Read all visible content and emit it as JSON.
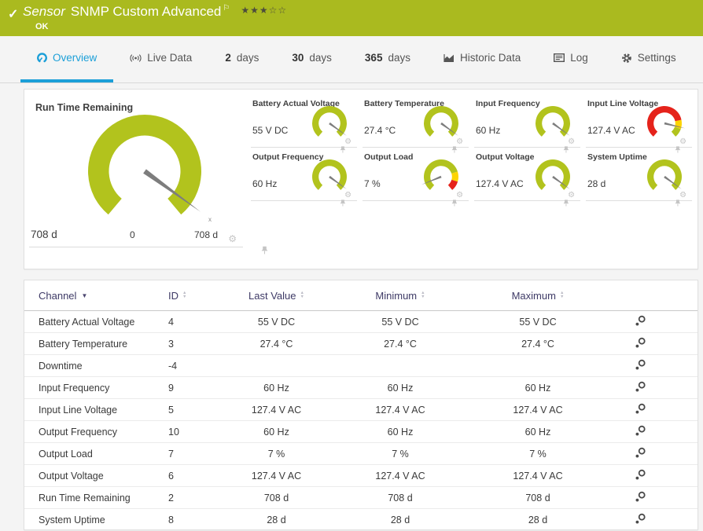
{
  "header": {
    "kind_label": "Sensor",
    "title": "SNMP Custom Advanced",
    "status_text": "OK",
    "stars_filled": "★★★",
    "stars_empty": "☆☆",
    "icons": {
      "checkmark": "✓",
      "flag": "⚐",
      "gear": "⚙"
    }
  },
  "tabs": [
    {
      "label": "Overview",
      "icon": "gauge-icon",
      "active": true
    },
    {
      "label": "Live Data",
      "icon": "live-data-icon",
      "active": false
    },
    {
      "strong": "2",
      "label": "days",
      "active": false
    },
    {
      "strong": "30",
      "label": "days",
      "active": false
    },
    {
      "strong": "365",
      "label": "days",
      "active": false
    },
    {
      "label": "Historic Data",
      "icon": "historic-data-icon",
      "active": false
    },
    {
      "label": "Log",
      "icon": "log-icon",
      "active": false
    },
    {
      "label": "Settings",
      "icon": "gear-icon",
      "active": false
    }
  ],
  "colors": {
    "header_bg": "#aaba1f",
    "accent_blue": "#1b9fd8",
    "gauge_green": "#b2c31d",
    "gauge_yellow": "#fdd400",
    "gauge_red": "#e5231b",
    "needle_gray": "#7d7d7d"
  },
  "main_gauge": {
    "title": "Run Time Remaining",
    "value": "708 d",
    "min_label": "0",
    "max_label": "708 d",
    "needle_marker": "x",
    "needle": 0.95,
    "segments": [
      {
        "color": "#b2c31d",
        "from": 0,
        "to": 1
      }
    ]
  },
  "small_gauges": [
    {
      "title": "Battery Actual Voltage",
      "value": "55 V DC",
      "needle": 0.95,
      "segments": [
        {
          "color": "#b2c31d",
          "from": 0,
          "to": 1
        }
      ]
    },
    {
      "title": "Battery Temperature",
      "value": "27.4 °C",
      "needle": 0.95,
      "segments": [
        {
          "color": "#b2c31d",
          "from": 0,
          "to": 1
        }
      ]
    },
    {
      "title": "Input Frequency",
      "value": "60 Hz",
      "needle": 0.95,
      "segments": [
        {
          "color": "#b2c31d",
          "from": 0,
          "to": 1
        }
      ]
    },
    {
      "title": "Input Line Voltage",
      "value": "127.4 V AC",
      "needle": 0.87,
      "segments": [
        {
          "color": "#e5231b",
          "from": 0,
          "to": 0.78
        },
        {
          "color": "#fdd400",
          "from": 0.78,
          "to": 0.89
        },
        {
          "color": "#b2c31d",
          "from": 0.89,
          "to": 1
        }
      ]
    },
    {
      "title": "Output Frequency",
      "value": "60 Hz",
      "needle": 0.95,
      "segments": [
        {
          "color": "#b2c31d",
          "from": 0,
          "to": 1
        }
      ]
    },
    {
      "title": "Output Load",
      "value": "7 %",
      "needle": 0.1,
      "segments": [
        {
          "color": "#b2c31d",
          "from": 0,
          "to": 0.76
        },
        {
          "color": "#fdd400",
          "from": 0.76,
          "to": 0.88
        },
        {
          "color": "#e5231b",
          "from": 0.88,
          "to": 1
        }
      ]
    },
    {
      "title": "Output Voltage",
      "value": "127.4 V AC",
      "needle": 0.95,
      "segments": [
        {
          "color": "#b2c31d",
          "from": 0,
          "to": 1
        }
      ]
    },
    {
      "title": "System Uptime",
      "value": "28 d",
      "needle": 0.95,
      "segments": [
        {
          "color": "#b2c31d",
          "from": 0,
          "to": 1
        }
      ]
    }
  ],
  "table": {
    "columns": [
      {
        "label": "Channel",
        "sort": "desc"
      },
      {
        "label": "ID",
        "sort": "both"
      },
      {
        "label": "Last Value",
        "sort": "both"
      },
      {
        "label": "Minimum",
        "sort": "both"
      },
      {
        "label": "Maximum",
        "sort": "both"
      }
    ],
    "rows": [
      {
        "channel": "Battery Actual Voltage",
        "id": "4",
        "last": "55 V DC",
        "min": "55 V DC",
        "max": "55 V DC"
      },
      {
        "channel": "Battery Temperature",
        "id": "3",
        "last": "27.4 °C",
        "min": "27.4 °C",
        "max": "27.4 °C"
      },
      {
        "channel": "Downtime",
        "id": "-4",
        "last": "",
        "min": "",
        "max": ""
      },
      {
        "channel": "Input Frequency",
        "id": "9",
        "last": "60 Hz",
        "min": "60 Hz",
        "max": "60 Hz"
      },
      {
        "channel": "Input Line Voltage",
        "id": "5",
        "last": "127.4 V AC",
        "min": "127.4 V AC",
        "max": "127.4 V AC"
      },
      {
        "channel": "Output Frequency",
        "id": "10",
        "last": "60 Hz",
        "min": "60 Hz",
        "max": "60 Hz"
      },
      {
        "channel": "Output Load",
        "id": "7",
        "last": "7 %",
        "min": "7 %",
        "max": "7 %"
      },
      {
        "channel": "Output Voltage",
        "id": "6",
        "last": "127.4 V AC",
        "min": "127.4 V AC",
        "max": "127.4 V AC"
      },
      {
        "channel": "Run Time Remaining",
        "id": "2",
        "last": "708 d",
        "min": "708 d",
        "max": "708 d"
      },
      {
        "channel": "System Uptime",
        "id": "8",
        "last": "28 d",
        "min": "28 d",
        "max": "28 d"
      }
    ]
  }
}
